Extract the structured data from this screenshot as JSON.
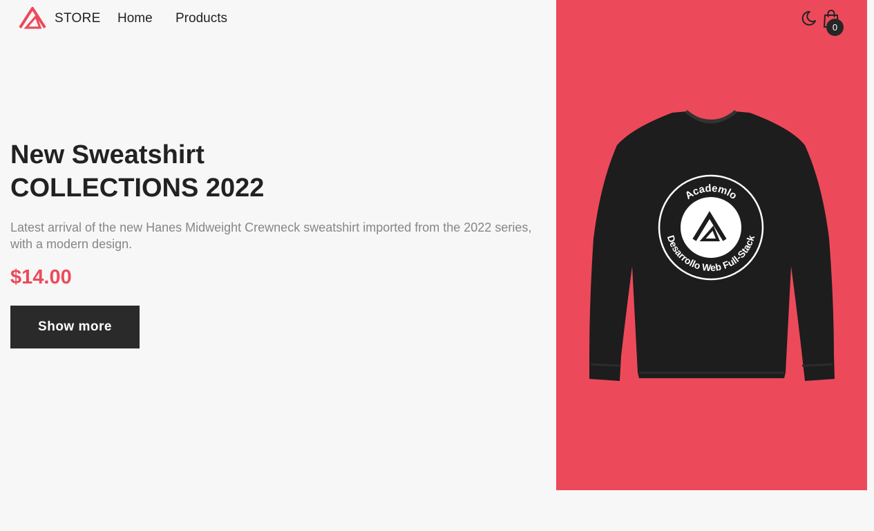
{
  "header": {
    "brand": "STORE",
    "nav": {
      "home": "Home",
      "products": "Products"
    },
    "cart_count": "0",
    "icons": {
      "logo": "academlo-logo",
      "theme": "moon-icon",
      "cart": "shopping-bag-icon"
    }
  },
  "hero": {
    "title_line1": "New Sweatshirt",
    "title_line2": "COLLECTIONS 2022",
    "description": "Latest arrival of the new Hanes Midweight Crewneck sweatshirt imported from the 2022 series, with a modern design.",
    "price": "$14.00",
    "cta_label": "Show more",
    "image": {
      "print_top": "Academlo",
      "print_bottom": "Desarrollo Web Full-Stack"
    }
  },
  "colors": {
    "accent": "#ec4a5a",
    "background": "#f7f7f7",
    "dark": "#2a2a2a",
    "muted_text": "#868686"
  }
}
